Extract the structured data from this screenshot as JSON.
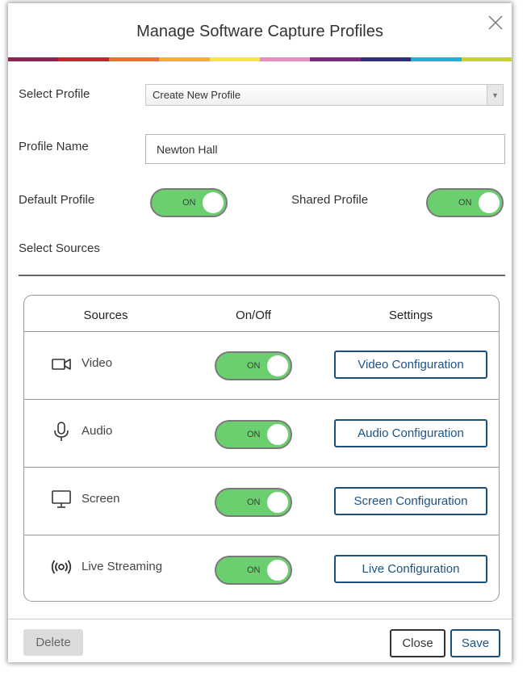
{
  "dialog": {
    "title": "Manage Software Capture Profiles",
    "close_icon": "close-icon",
    "color_bar": [
      "#8e2350",
      "#c8262f",
      "#e8722d",
      "#f5b12b",
      "#f7e63b",
      "#e98dbd",
      "#7c2a7e",
      "#2e2e7a",
      "#1fb1dd",
      "#c7d42c"
    ]
  },
  "form": {
    "select_profile_label": "Select Profile",
    "select_profile_value": "Create New Profile",
    "profile_name_label": "Profile Name",
    "profile_name_value": "Newton Hall",
    "default_profile_label": "Default Profile",
    "default_profile_state": "ON",
    "shared_profile_label": "Shared Profile",
    "shared_profile_state": "ON",
    "select_sources_label": "Select Sources"
  },
  "sources_table": {
    "headers": [
      "Sources",
      "On/Off",
      "Settings"
    ],
    "rows": [
      {
        "icon": "video-camera-icon",
        "label": "Video",
        "state": "ON",
        "button": "Video Configuration"
      },
      {
        "icon": "microphone-icon",
        "label": "Audio",
        "state": "ON",
        "button": "Audio Configuration"
      },
      {
        "icon": "monitor-icon",
        "label": "Screen",
        "state": "ON",
        "button": "Screen Configuration"
      },
      {
        "icon": "broadcast-icon",
        "label": "Live Streaming",
        "state": "ON",
        "button": "Live Configuration"
      }
    ]
  },
  "footer": {
    "delete_label": "Delete",
    "close_label": "Close",
    "save_label": "Save"
  },
  "colors": {
    "toggle_on": "#6bce6f",
    "accent_blue": "#1c4f7c"
  }
}
